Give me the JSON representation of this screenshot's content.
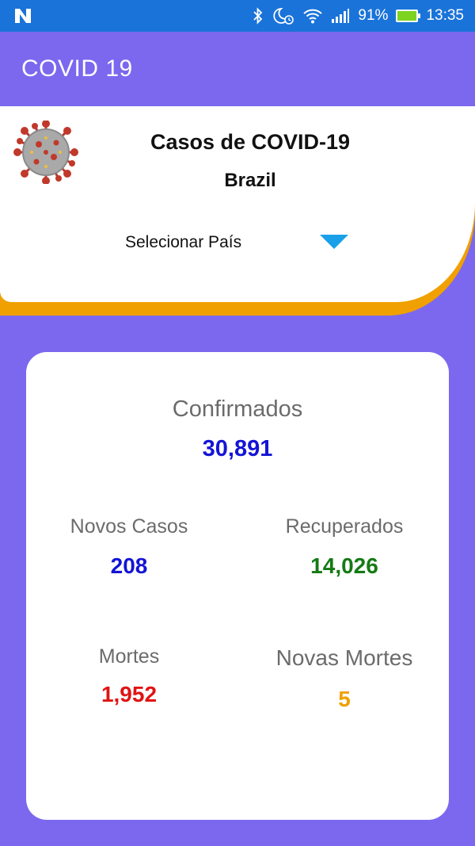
{
  "status_bar": {
    "battery": "91%",
    "time": "13:35",
    "icons": [
      "n-icon",
      "bluetooth-icon",
      "alarm-icon",
      "wifi-icon",
      "signal-icon",
      "battery-icon"
    ]
  },
  "app_bar": {
    "title": "COVID 19"
  },
  "header": {
    "title": "Casos de COVID-19",
    "country": "Brazil",
    "select_label": "Selecionar País"
  },
  "stats": {
    "confirmed": {
      "label": "Confirmados",
      "value": "30,891",
      "color": "#1414d6"
    },
    "new_cases": {
      "label": "Novos Casos",
      "value": "208",
      "color": "#1414d6"
    },
    "recovered": {
      "label": "Recuperados",
      "value": "14,026",
      "color": "#147a14"
    },
    "deaths": {
      "label": "Mortes",
      "value": "1,952",
      "color": "#e01414"
    },
    "new_deaths": {
      "label": "Novas Mortes",
      "value": "5",
      "color": "#f0a000"
    }
  },
  "colors": {
    "primary": "#7b68ee",
    "status_bar": "#1a73d9",
    "accent_orange": "#f0a000",
    "dropdown": "#1aa0e8"
  }
}
